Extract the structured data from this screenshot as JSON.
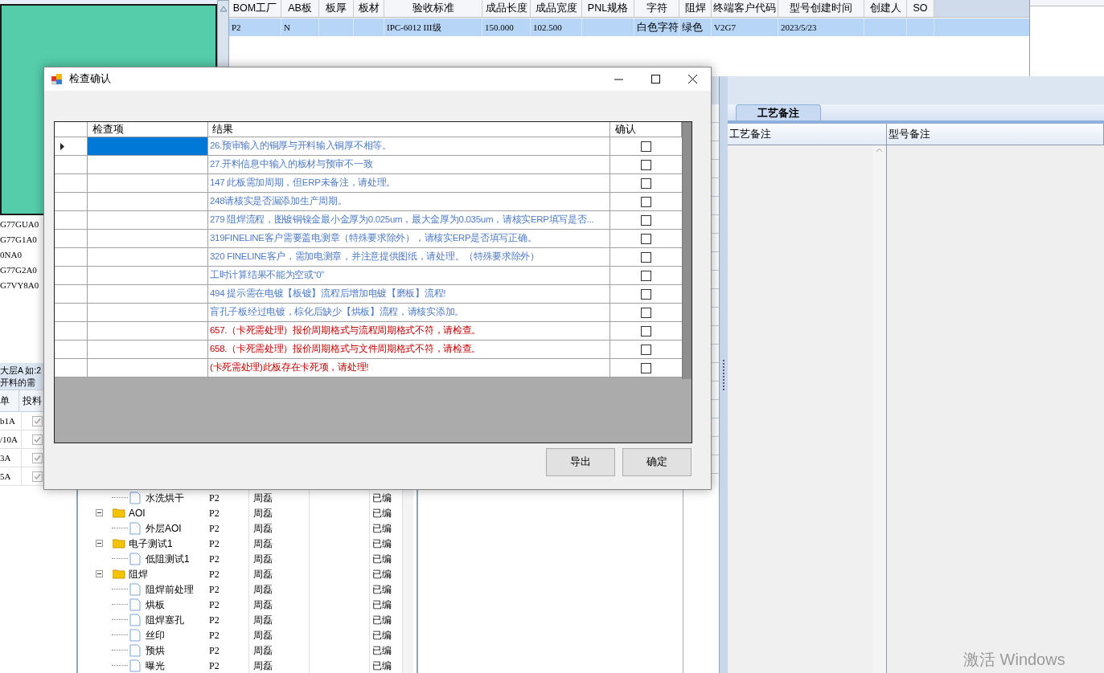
{
  "main_table": {
    "columns": [
      "BOM工厂",
      "AB板",
      "板厚",
      "板材",
      "验收标准",
      "成品长度",
      "成品宽度",
      "PNL规格",
      "字符",
      "阻焊",
      "终端客户代码",
      "型号创建时间",
      "创建人",
      "SO"
    ],
    "rows": [
      {
        "selected": true,
        "cells": {
          "0": "P2",
          "1": "N",
          "4": "IPC-6012 III级",
          "5": "150.000",
          "6": "102.500",
          "8": "白色字符",
          "9": "绿色",
          "10": "V2G7",
          "11": "2023/5/23"
        }
      }
    ]
  },
  "code_list": [
    "G77GUA0",
    "G77G1A0",
    "0NA0",
    "G77G2A0",
    "G7VY8A0"
  ],
  "notes": [
    "大层A 如:2",
    "开料的需"
  ],
  "feed_table": {
    "columns": [
      "单",
      "投料"
    ],
    "rows": [
      {
        "text": "b1A",
        "checked": true
      },
      {
        "text": "/10A",
        "checked": true
      },
      {
        "text": "3A",
        "checked": true
      },
      {
        "text": "5A",
        "checked": true
      }
    ]
  },
  "tree": {
    "continued": [
      {
        "name": "水洗烘干",
        "column_2": "P2",
        "column_3": "周磊",
        "column_5": "已编"
      }
    ],
    "nodes": [
      {
        "name": "AOI",
        "column_2": "P2",
        "column_3": "周磊",
        "column_5": "已编",
        "expanded": true,
        "children": [
          {
            "name": "外层AOI",
            "column_2": "P2",
            "column_3": "周磊",
            "column_5": "已编"
          }
        ]
      },
      {
        "name": "电子测试1",
        "column_2": "P2",
        "column_3": "周磊",
        "column_5": "已编",
        "expanded": true,
        "children": [
          {
            "name": "低阻测试1",
            "column_2": "P2",
            "column_3": "周磊",
            "column_5": "已编"
          }
        ]
      },
      {
        "name": "阻焊",
        "column_2": "P2",
        "column_3": "周磊",
        "column_5": "已编",
        "expanded": true,
        "children": [
          {
            "name": "阻焊前处理",
            "column_2": "P2",
            "column_3": "周磊",
            "column_5": "已编"
          },
          {
            "name": "烘板",
            "column_2": "P2",
            "column_3": "周磊",
            "column_5": "已编"
          },
          {
            "name": "阻焊塞孔",
            "column_2": "P2",
            "column_3": "周磊",
            "column_5": "已编"
          },
          {
            "name": "丝印",
            "column_2": "P2",
            "column_3": "周磊",
            "column_5": "已编"
          },
          {
            "name": "预烘",
            "column_2": "P2",
            "column_3": "周磊",
            "column_5": "已编"
          },
          {
            "name": "曝光",
            "column_2": "P2",
            "column_3": "周磊",
            "column_5": "已编"
          }
        ]
      }
    ]
  },
  "remarks_panel": {
    "tabs": [
      {
        "label": "工艺备注",
        "selected": true
      }
    ],
    "columns": [
      "工艺备注",
      "型号备注"
    ]
  },
  "dialog": {
    "title": "检查确认",
    "columns": [
      "检查项",
      "结果",
      "确认"
    ],
    "rows": [
      {
        "selected": true,
        "kind": "warning",
        "result": "26.预审输入的铜厚与开料输入铜厚不相等。",
        "confirmed": false
      },
      {
        "selected": false,
        "kind": "warning",
        "result": "27.开料信息中输入的板材与预审不一致",
        "confirmed": false
      },
      {
        "selected": false,
        "kind": "warning",
        "result": "147 此板需加周期，但ERP未备注，请处理。",
        "confirmed": false
      },
      {
        "selected": false,
        "kind": "warning",
        "result": "248请核实是否漏添加生产周期。",
        "confirmed": false
      },
      {
        "selected": false,
        "kind": "warning",
        "result": "279 阻焊流程，图镀铜镍金最小金厚为0.025um，最大金厚为0.035um，请核实ERP填写是否...",
        "confirmed": false
      },
      {
        "selected": false,
        "kind": "warning",
        "result": "319FINELINE客户需要盖电测章（特殊要求除外），请核实ERP是否填写正确。",
        "confirmed": false
      },
      {
        "selected": false,
        "kind": "warning",
        "result": "320 FINELINE客户，需加电测章，并注意提供图纸，请处理。（特殊要求除外）",
        "confirmed": false
      },
      {
        "selected": false,
        "kind": "warning",
        "result": "工时计算结果不能为空或“0”",
        "confirmed": false
      },
      {
        "selected": false,
        "kind": "warning",
        "result": "494 提示需在电镀【板镀】流程后增加电镀【磨板】流程!",
        "confirmed": false
      },
      {
        "selected": false,
        "kind": "warning",
        "result": "盲孔子板经过电镀，棕化后缺少【烘板】流程，请核实添加。",
        "confirmed": false
      },
      {
        "selected": false,
        "kind": "blocking",
        "result": "657.（卡死需处理）报价周期格式与流程周期格式不符，请检查。",
        "confirmed": false
      },
      {
        "selected": false,
        "kind": "blocking",
        "result": "658.（卡死需处理）报价周期格式与文件周期格式不符，请检查。",
        "confirmed": false
      },
      {
        "selected": false,
        "kind": "blocking",
        "result": "(卡死需处理)此板存在卡死项，请处理!",
        "confirmed": false
      }
    ],
    "buttons": [
      "导出",
      "确定"
    ]
  },
  "watermark_text": "激活 Windows"
}
